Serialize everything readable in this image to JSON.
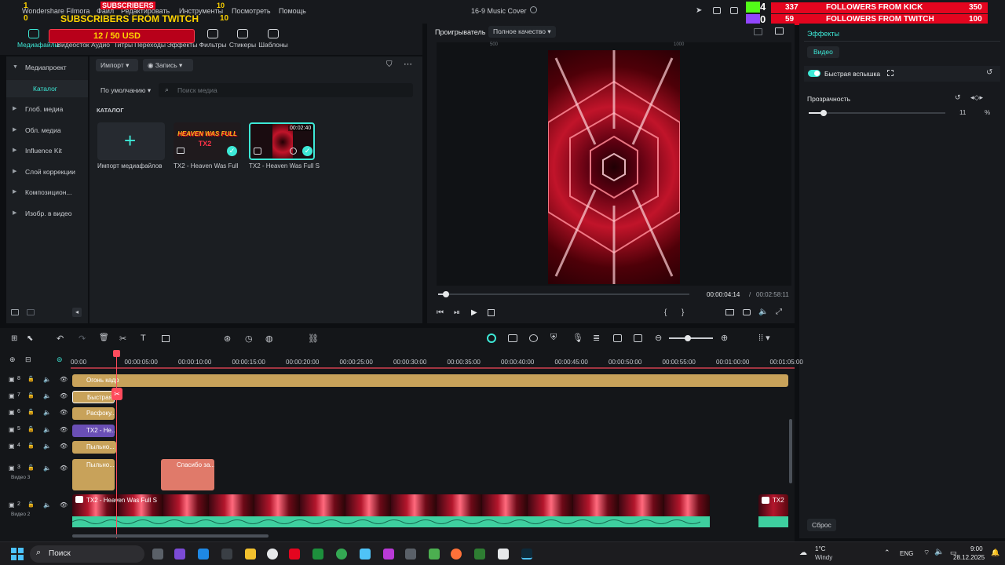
{
  "titlebar": {
    "app_name": "Wondershare Filmora",
    "menus": [
      "Файл",
      "Редактировать",
      "Инструменты",
      "Посмотреть",
      "Помощь"
    ],
    "project_title": "16-9 Music Cover"
  },
  "stream_overlays": {
    "subs_left_count": "1",
    "subs_left_label": "SUBSCRIBERS",
    "subs_mid_count": "10",
    "twitch_subs_count": "0",
    "twitch_subs_label": "SUBSCRIBERS FROM TWITCH",
    "twitch_subs_right": "10",
    "goal": "12 / 50 USD",
    "kick_live_count": "4",
    "twitch_live_count": "0",
    "kick_followers_left": "337",
    "kick_followers_label": "FOLLOWERS FROM KICK",
    "kick_followers_right": "350",
    "twitch_followers_left": "59",
    "twitch_followers_label": "FOLLOWERS FROM TWITCH",
    "twitch_followers_right": "100"
  },
  "toolbar": {
    "tabs": [
      "Медиафайлы",
      "Видеосток",
      "Аудио",
      "Титры",
      "Переходы",
      "Эффекты",
      "Фильтры",
      "Стикеры",
      "Шаблоны"
    ],
    "active_tab": "Медиафайлы"
  },
  "left_nav": {
    "items": [
      "Медиапроект",
      "Каталог",
      "Глоб. медиа",
      "Обл. медиа",
      "Influence Kit",
      "Слой коррекции",
      "Композицион...",
      "Изобр. в видео"
    ],
    "selected": "Каталог"
  },
  "media": {
    "import_btn": "Импорт",
    "record_btn": "Запись",
    "sort": "По умолчанию",
    "search_placeholder": "Поиск медиа",
    "section_label": "КАТАЛОГ",
    "items": [
      {
        "caption": "Импорт медиафайлов"
      },
      {
        "caption": "TX2 - Heaven Was Full",
        "art_text": "HEAVEN WAS FULL"
      },
      {
        "caption": "TX2 - Heaven Was Full S",
        "duration": "00:02:40"
      }
    ]
  },
  "player": {
    "tab": "Проигрыватель",
    "quality": "Полное качество",
    "current_time": "00:00:04:14",
    "separator": "/",
    "total_time": "00:02:58:11",
    "ruler_marks": [
      "500",
      "1000"
    ],
    "progress_fraction": 0.03
  },
  "properties": {
    "tab": "Эффекты",
    "subtab": "Видео",
    "effect_name": "Быстрая вспышка",
    "opacity_label": "Прозрачность",
    "opacity_value": "11",
    "opacity_unit": "%",
    "opacity_fraction": 0.11,
    "reset_btn": "Сброс"
  },
  "timeline": {
    "ruler": [
      "00:00",
      "00:00:05:00",
      "00:00:10:00",
      "00:00:15:00",
      "00:00:20:00",
      "00:00:25:00",
      "00:00:30:00",
      "00:00:35:00",
      "00:00:40:00",
      "00:00:45:00",
      "00:00:50:00",
      "00:00:55:00",
      "00:01:00:00",
      "00:01:05:00"
    ],
    "tracks": [
      {
        "num": "8",
        "clip": "Огонь кадр"
      },
      {
        "num": "7",
        "clip": "Быстрая"
      },
      {
        "num": "6",
        "clip": "Расфоку..."
      },
      {
        "num": "5",
        "clip": "TX2 - Не..."
      },
      {
        "num": "4",
        "clip": "Пыльно..."
      },
      {
        "num": "3",
        "clip": "Пыльно...",
        "label": "Видео 3",
        "extra_clip": "Спасибо за..."
      },
      {
        "num": "2",
        "clip": "TX2 - Heaven Was Full S",
        "label": "Видео 2",
        "end_clip": "TX2"
      }
    ]
  },
  "taskbar": {
    "search": "Поиск",
    "weather_temp": "1°C",
    "weather_desc": "Windy",
    "lang": "ENG",
    "time": "9:00",
    "date": "28.12.2025"
  },
  "colors": {
    "accent": "#3de8d6",
    "clip_gold": "#c8a25a",
    "clip_purple": "#6a4fb5",
    "clip_salmon": "#e07a6a",
    "audio_green": "#3ecf9f",
    "playhead": "#ff4b5c"
  }
}
